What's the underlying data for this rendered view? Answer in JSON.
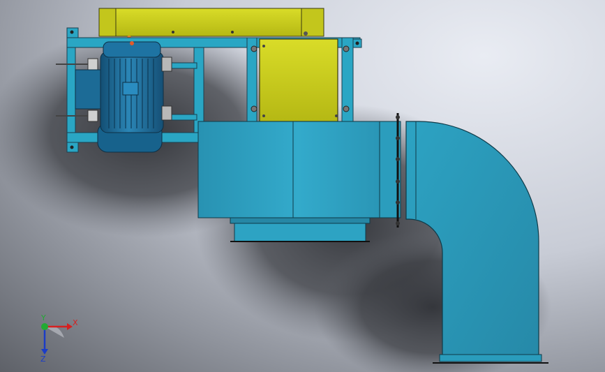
{
  "viewport": {
    "model_name": "blower-motor-assembly",
    "view": "front"
  },
  "colors": {
    "background_light": "#e9ecf3",
    "shadow": "#2f3136",
    "frame_blue": "#2aa6c4",
    "duct_blue": "#2d9fbf",
    "duct_highlight": "#39b6d6",
    "motor_blue": "#1d6f9c",
    "guard_yellow": "#c8cc1e",
    "axis_x": "#d62020",
    "axis_y": "#22aa33",
    "axis_z": "#1b3cc7"
  },
  "triad": {
    "x_label": "X",
    "y_label": "Y",
    "z_label": "Z"
  }
}
